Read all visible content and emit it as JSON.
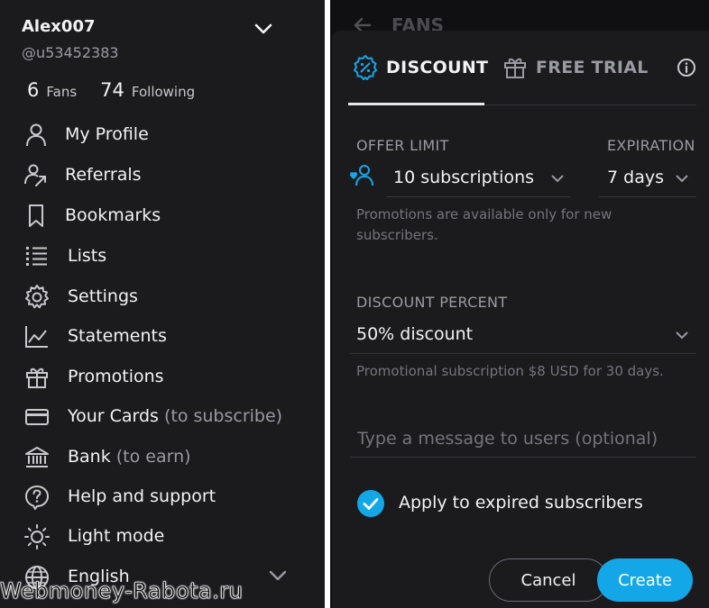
{
  "sidebar": {
    "user": {
      "name": "Alex007",
      "handle": "@u53452383"
    },
    "stats": {
      "fans_count": "6",
      "fans_label": "Fans",
      "following_count": "74",
      "following_label": "Following"
    },
    "items": [
      {
        "label": "My Profile",
        "sub": "",
        "icon": "user-icon"
      },
      {
        "label": "Referrals",
        "sub": "",
        "icon": "referrals-icon"
      },
      {
        "label": "Bookmarks",
        "sub": "",
        "icon": "bookmark-icon"
      },
      {
        "label": "Lists",
        "sub": "",
        "icon": "list-icon"
      },
      {
        "label": "Settings",
        "sub": "",
        "icon": "gear-icon"
      },
      {
        "label": "Statements",
        "sub": "",
        "icon": "chart-line-icon"
      },
      {
        "label": "Promotions",
        "sub": "",
        "icon": "gift-icon"
      },
      {
        "label": "Your Cards",
        "sub": "(to subscribe)",
        "icon": "card-icon"
      },
      {
        "label": "Bank",
        "sub": "(to earn)",
        "icon": "bank-icon"
      },
      {
        "label": "Help and support",
        "sub": "",
        "icon": "help-icon"
      },
      {
        "label": "Light mode",
        "sub": "",
        "icon": "sun-icon"
      },
      {
        "label": "English",
        "sub": "",
        "icon": "globe-icon"
      }
    ]
  },
  "watermark": "Webmoney-Rabota.ru",
  "background_page": {
    "title": "FANS"
  },
  "modal": {
    "tabs": [
      {
        "label": "DISCOUNT",
        "active": true,
        "icon": "discount-badge-icon"
      },
      {
        "label": "FREE TRIAL",
        "active": false,
        "icon": "gift-icon"
      }
    ],
    "offer_limit": {
      "label": "OFFER LIMIT",
      "value": "10 subscriptions"
    },
    "expiration": {
      "label": "EXPIRATION",
      "value": "7 days"
    },
    "offer_hint": "Promotions are available only for new subscribers.",
    "discount_percent": {
      "label": "DISCOUNT PERCENT",
      "value": "50% discount"
    },
    "discount_hint": "Promotional subscription $8 USD for 30 days.",
    "message": {
      "placeholder": "Type a message to users (optional)",
      "value": ""
    },
    "apply_expired": {
      "label": "Apply to expired subscribers",
      "checked": true
    },
    "buttons": {
      "cancel": "Cancel",
      "create": "Create"
    }
  },
  "colors": {
    "accent": "#14a7e8",
    "panel": "#1b1b1e",
    "text_muted": "#9a9aa1"
  }
}
